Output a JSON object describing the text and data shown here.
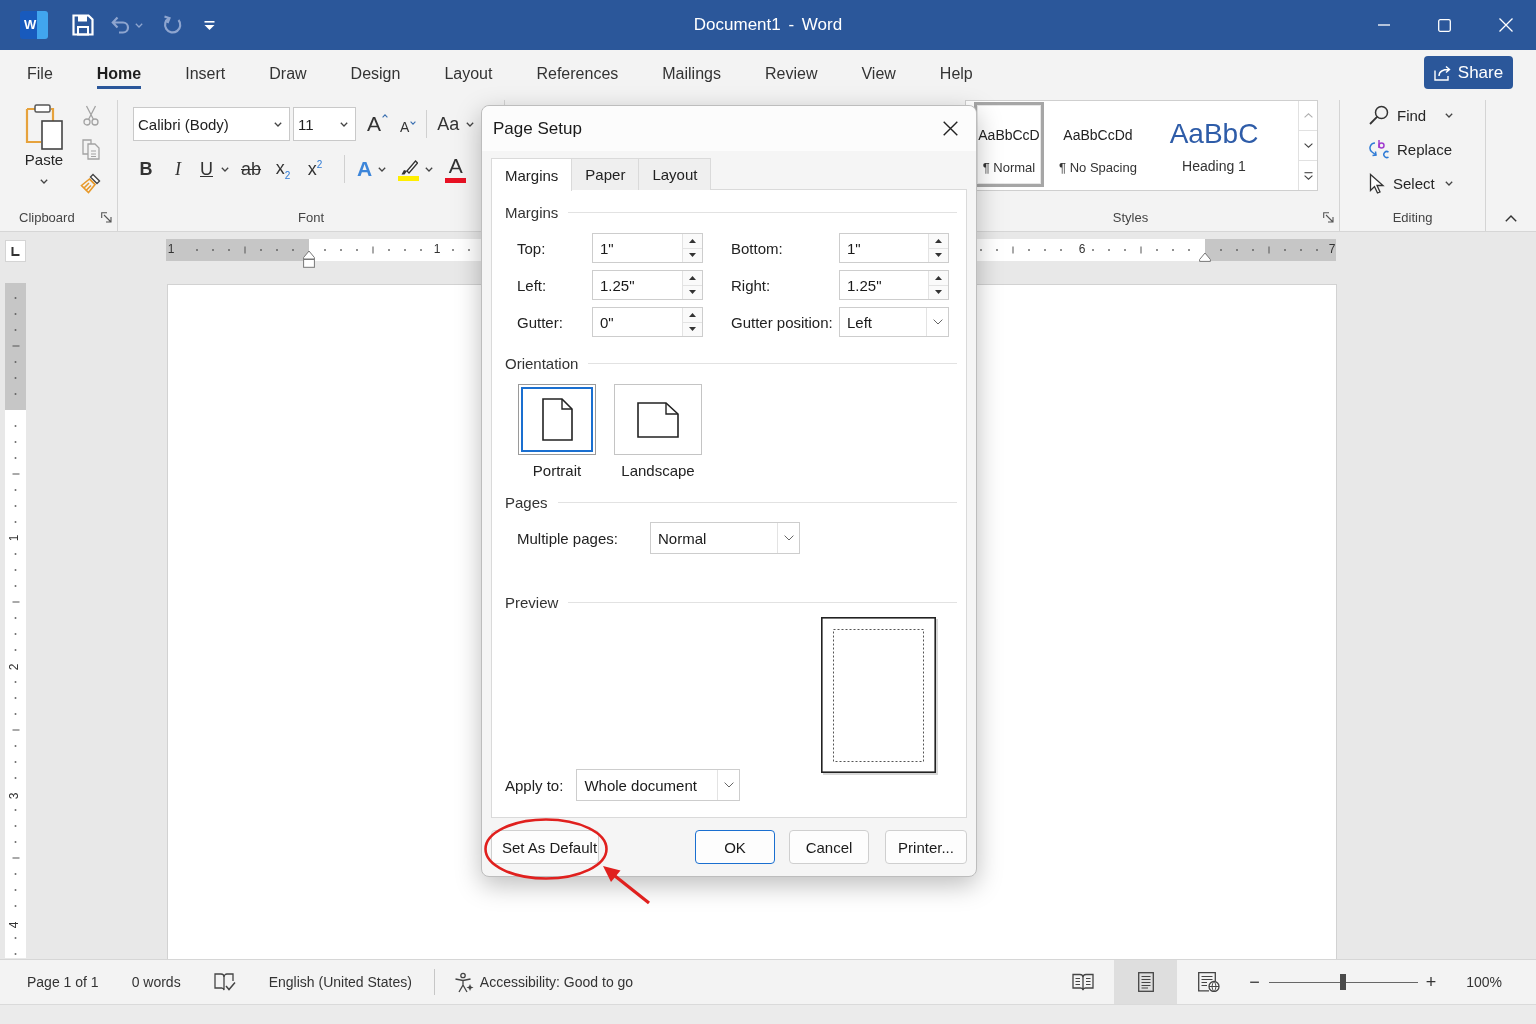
{
  "title_bar": {
    "logo_letter": "W",
    "quick_access": [
      {
        "kind": "save",
        "disabled": false
      },
      {
        "kind": "undo",
        "disabled": true
      },
      {
        "kind": "redo",
        "disabled": true
      },
      {
        "kind": "customize",
        "disabled": false
      }
    ],
    "title": "Document1 - Word"
  },
  "ribbon_tabs": [
    {
      "label": "File",
      "selected": false
    },
    {
      "label": "Home",
      "selected": true
    },
    {
      "label": "Insert",
      "selected": false
    },
    {
      "label": "Draw",
      "selected": false
    },
    {
      "label": "Design",
      "selected": false
    },
    {
      "label": "Layout",
      "selected": false
    },
    {
      "label": "References",
      "selected": false
    },
    {
      "label": "Mailings",
      "selected": false
    },
    {
      "label": "Review",
      "selected": false
    },
    {
      "label": "View",
      "selected": false
    },
    {
      "label": "Help",
      "selected": false
    }
  ],
  "share_button": {
    "label": "Share"
  },
  "ribbon": {
    "clipboard": {
      "label": "Clipboard",
      "paste_label": "Paste",
      "tools": [
        {
          "kind": "cut",
          "disabled": true
        },
        {
          "kind": "copy",
          "disabled": true
        },
        {
          "kind": "format_painter",
          "disabled": false
        }
      ]
    },
    "font": {
      "label": "Font",
      "font_name": "Calibri (Body)",
      "font_size": "11",
      "size_buttons": [
        {
          "kind": "grow",
          "glyph": "A"
        },
        {
          "kind": "shrink",
          "glyph": "A"
        }
      ],
      "case_button": {
        "glyph": "Aa"
      },
      "format_buttons": [
        {
          "kind": "bold",
          "glyph": "B"
        },
        {
          "kind": "italic",
          "glyph": "I"
        },
        {
          "kind": "underline",
          "glyph": "U"
        },
        {
          "kind": "strikethrough",
          "glyph": "ab"
        },
        {
          "kind": "subscript",
          "glyph": "x$_{2}$"
        },
        {
          "kind": "superscript",
          "glyph": "x$^{2}$"
        }
      ],
      "color_buttons": [
        {
          "kind": "text_effects",
          "glyph": "A"
        },
        {
          "kind": "highlight",
          "color": "#ffee00"
        },
        {
          "kind": "font_color",
          "glyph": "A",
          "color": "#e81123"
        }
      ]
    },
    "styles": {
      "label": "Styles",
      "items": [
        {
          "kind": "normal",
          "preview": "AaBbCcD",
          "name": "¶ Normal",
          "selected": true
        },
        {
          "kind": "no_spacing",
          "preview": "AaBbCcDd",
          "name": "¶ No Spacing",
          "selected": false
        },
        {
          "kind": "heading",
          "preview": "AaBbC",
          "name": "Heading 1",
          "selected": false
        }
      ]
    },
    "editing": {
      "label": "Editing",
      "items": [
        {
          "kind": "find",
          "label": "Find"
        },
        {
          "kind": "replace",
          "label": "Replace"
        },
        {
          "kind": "select",
          "label": "Select"
        }
      ]
    }
  },
  "rulers": {
    "horizontal_numbers": [
      "1",
      "1",
      "6",
      "7"
    ],
    "vertical_numbers": [
      "1",
      "2",
      "3",
      "4"
    ]
  },
  "dialog": {
    "title": "Page Setup",
    "tabs": [
      {
        "label": "Margins",
        "selected": true
      },
      {
        "label": "Paper",
        "selected": false
      },
      {
        "label": "Layout",
        "selected": false
      }
    ],
    "margins_heading": "Margins",
    "fields": [
      {
        "kind": "spin",
        "label": "Top:",
        "value": "1\""
      },
      {
        "kind": "spin",
        "label": "Bottom:",
        "value": "1\""
      },
      {
        "kind": "spin",
        "label": "Left:",
        "value": "1.25\""
      },
      {
        "kind": "spin",
        "label": "Right:",
        "value": "1.25\""
      },
      {
        "kind": "spin",
        "label": "Gutter:",
        "value": "0\""
      },
      {
        "kind": "dropdown",
        "label": "Gutter position:",
        "value": "Left"
      }
    ],
    "orientation": {
      "heading": "Orientation",
      "options": [
        {
          "kind": "portrait",
          "label": "Portrait",
          "selected": true
        },
        {
          "kind": "landscape",
          "label": "Landscape",
          "selected": false
        }
      ]
    },
    "pages": {
      "heading": "Pages",
      "label": "Multiple pages:",
      "value": "Normal"
    },
    "preview": {
      "heading": "Preview"
    },
    "apply_to": {
      "label": "Apply to:",
      "value": "Whole document"
    },
    "buttons": [
      {
        "kind": "secondary",
        "label": "Set As Default"
      },
      {
        "kind": "primary",
        "label": "OK"
      },
      {
        "kind": "secondary",
        "label": "Cancel"
      },
      {
        "kind": "secondary",
        "label": "Printer..."
      }
    ]
  },
  "status_bar": {
    "items": [
      {
        "kind": "text",
        "text": "Page 1 of 1"
      },
      {
        "kind": "text",
        "text": "0 words"
      },
      {
        "kind": "proofing"
      },
      {
        "kind": "text",
        "text": "English (United States)"
      },
      {
        "kind": "separator"
      },
      {
        "kind": "accessibility",
        "text": "Accessibility: Good to go"
      }
    ],
    "views": [
      {
        "kind": "read",
        "selected": false
      },
      {
        "kind": "print",
        "selected": true
      },
      {
        "kind": "web",
        "selected": false
      }
    ],
    "zoom": {
      "minus": "−",
      "plus": "+",
      "level": 0.5,
      "reading": "100%"
    }
  },
  "callout": {
    "kind": "ellipse",
    "pointer": true
  }
}
